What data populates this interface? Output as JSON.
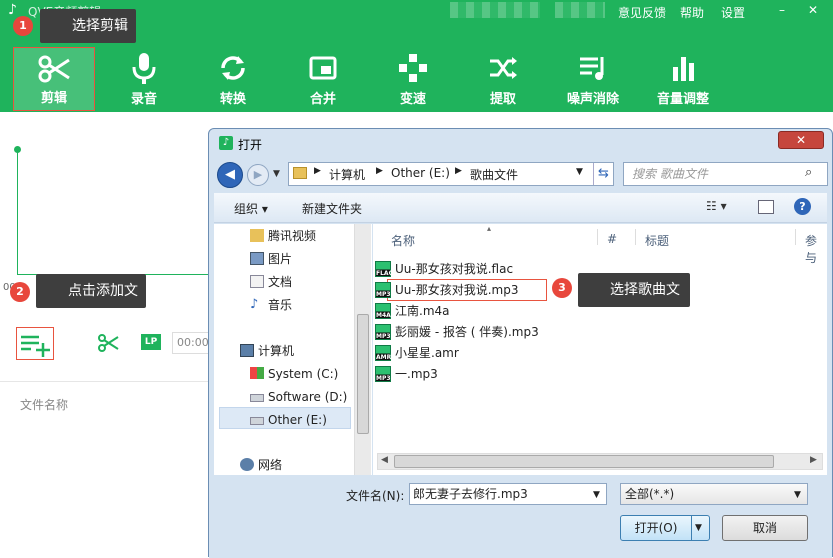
{
  "app": {
    "title": "QVE音频剪辑",
    "top_links": {
      "feedback": "意见反馈",
      "help": "帮助",
      "settings": "设置"
    },
    "window_controls": {
      "minimize": "–",
      "close": "✕"
    },
    "tools": [
      {
        "label": "剪辑",
        "icon": "scissors-icon"
      },
      {
        "label": "录音",
        "icon": "microphone-icon"
      },
      {
        "label": "转换",
        "icon": "convert-icon"
      },
      {
        "label": "合并",
        "icon": "merge-icon"
      },
      {
        "label": "变速",
        "icon": "speed-icon"
      },
      {
        "label": "提取",
        "icon": "extract-icon"
      },
      {
        "label": "噪声消除",
        "icon": "noise-removal-icon"
      },
      {
        "label": "音量调整",
        "icon": "volume-icon"
      }
    ],
    "time_start": "00:0",
    "time_input": "00:00",
    "lp": "LP",
    "file_name_header": "文件名称",
    "accent": "#1fb35c"
  },
  "callouts": [
    {
      "num": "1",
      "text": "选择剪辑"
    },
    {
      "num": "2",
      "text": "点击添加文件"
    },
    {
      "num": "3",
      "text": "选择歌曲文件"
    }
  ],
  "dialog": {
    "title": "打开",
    "close": "✕",
    "path": [
      "计算机",
      "Other (E:)",
      "歌曲文件"
    ],
    "search_placeholder": "搜索 歌曲文件",
    "toolbar": {
      "organize": "组织 ▾",
      "new_folder": "新建文件夹"
    },
    "nav_items": [
      {
        "label": "腾讯视频",
        "icon": "folder-icon"
      },
      {
        "label": "图片",
        "icon": "pictures-icon"
      },
      {
        "label": "文档",
        "icon": "documents-icon"
      },
      {
        "label": "音乐",
        "icon": "music-icon"
      },
      {
        "label": "计算机",
        "icon": "computer-icon"
      },
      {
        "label": "System (C:)",
        "icon": "system-drive-icon"
      },
      {
        "label": "Software (D:)",
        "icon": "drive-icon"
      },
      {
        "label": "Other (E:)",
        "icon": "drive-icon"
      },
      {
        "label": "网络",
        "icon": "network-icon"
      }
    ],
    "columns": {
      "name": "名称",
      "num": "#",
      "title": "标题",
      "artist": "参与"
    },
    "files": [
      {
        "name": "Uu-那女孩对我说.flac",
        "ext": "FLAC"
      },
      {
        "name": "Uu-那女孩对我说.mp3",
        "ext": "MP3"
      },
      {
        "name": "江南.m4a",
        "ext": "M4A"
      },
      {
        "name": "彭丽媛 - 报答 ( 伴奏).mp3",
        "ext": "MP3"
      },
      {
        "name": "小星星.amr",
        "ext": "AMR"
      },
      {
        "name": "一.mp3",
        "ext": "MP3"
      }
    ],
    "filename_label": "文件名(N):",
    "filename_value": "郎无妻子去修行.mp3",
    "filter": "全部(*.*)",
    "open_button": "打开(O)",
    "cancel_button": "取消"
  }
}
